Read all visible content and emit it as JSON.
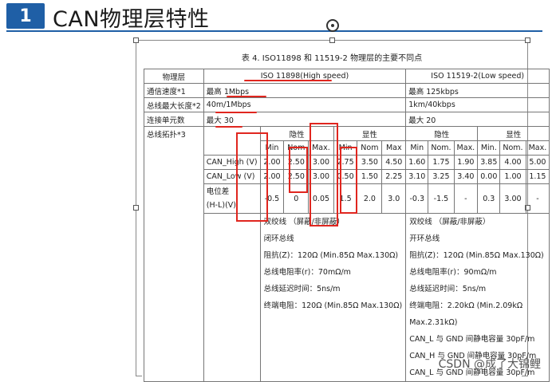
{
  "header": {
    "badge": "1",
    "title": "CAN物理层特性"
  },
  "doc": {
    "caption": "表 4.  ISO11898 和 11519-2 物理层的主要不同点",
    "col_headers": [
      "物理层",
      "ISO 11898(High speed)",
      "ISO 11519-2(Low speed)"
    ],
    "rows": [
      [
        "通信速度*1",
        "最高 1Mbps",
        "最高 125kbps"
      ],
      [
        "总线最大长度*2",
        "40m/1Mbps",
        "1km/40kbps"
      ],
      [
        "连接单元数",
        "最大 30",
        "最大 20"
      ]
    ],
    "topology_label": "总线拓扑*3",
    "states": [
      "隐性",
      "显性",
      "隐性",
      "显性"
    ],
    "sub_headers": [
      "Min",
      "Nom",
      "Max.",
      "Min",
      "Nom",
      "Max",
      "Min",
      "Nom.",
      "Max.",
      "Min.",
      "Nom.",
      "Max."
    ],
    "signal_rows": [
      {
        "name": "CAN_High (V)",
        "values": [
          "2.00",
          "2.50",
          "3.00",
          "2.75",
          "3.50",
          "4.50",
          "1.60",
          "1.75",
          "1.90",
          "3.85",
          "4.00",
          "5.00"
        ]
      },
      {
        "name": "CAN_Low (V)",
        "values": [
          "2.00",
          "2.50",
          "3.00",
          "0.50",
          "1.50",
          "2.25",
          "3.10",
          "3.25",
          "3.40",
          "0.00",
          "1.00",
          "1.15"
        ]
      },
      {
        "name": "电位差",
        "name2": "(H-L)(V)",
        "values": [
          "-0.5",
          "0",
          "0.05",
          "1.5",
          "2.0",
          "3.0",
          "-0.3",
          "-1.5",
          "-",
          "0.3",
          "3.00",
          "-"
        ]
      }
    ],
    "notes_left": [
      "双绞线  （屏蔽/非屏蔽）",
      "闭环总线",
      "阻抗(Z)：120Ω (Min.85Ω Max.130Ω)",
      "总线电阻率(r)：70mΩ/m",
      "总线延迟时间：5ns/m",
      "终端电阻：120Ω (Min.85Ω Max.130Ω)"
    ],
    "notes_right": [
      "双绞线  （屏蔽/非屏蔽）",
      "开环总线",
      "阻抗(Z)：120Ω (Min.85Ω Max.130Ω)",
      "总线电阻率(r)：90mΩ/m",
      "总线延迟时间：5ns/m",
      "终端电阻：2.20kΩ (Min.2.09kΩ",
      "Max.2.31kΩ)",
      "CAN_L 与 GND 间静电容量   30pF/m",
      "CAN_H 与 GND 间静电容量   30pF/m",
      "CAN_L 与 GND 间静电容量   30pF/m"
    ]
  },
  "watermark": "CSDN @成了大锦鲤",
  "colors": {
    "accent": "#1f5fa6",
    "annotation": "#e0261f"
  }
}
